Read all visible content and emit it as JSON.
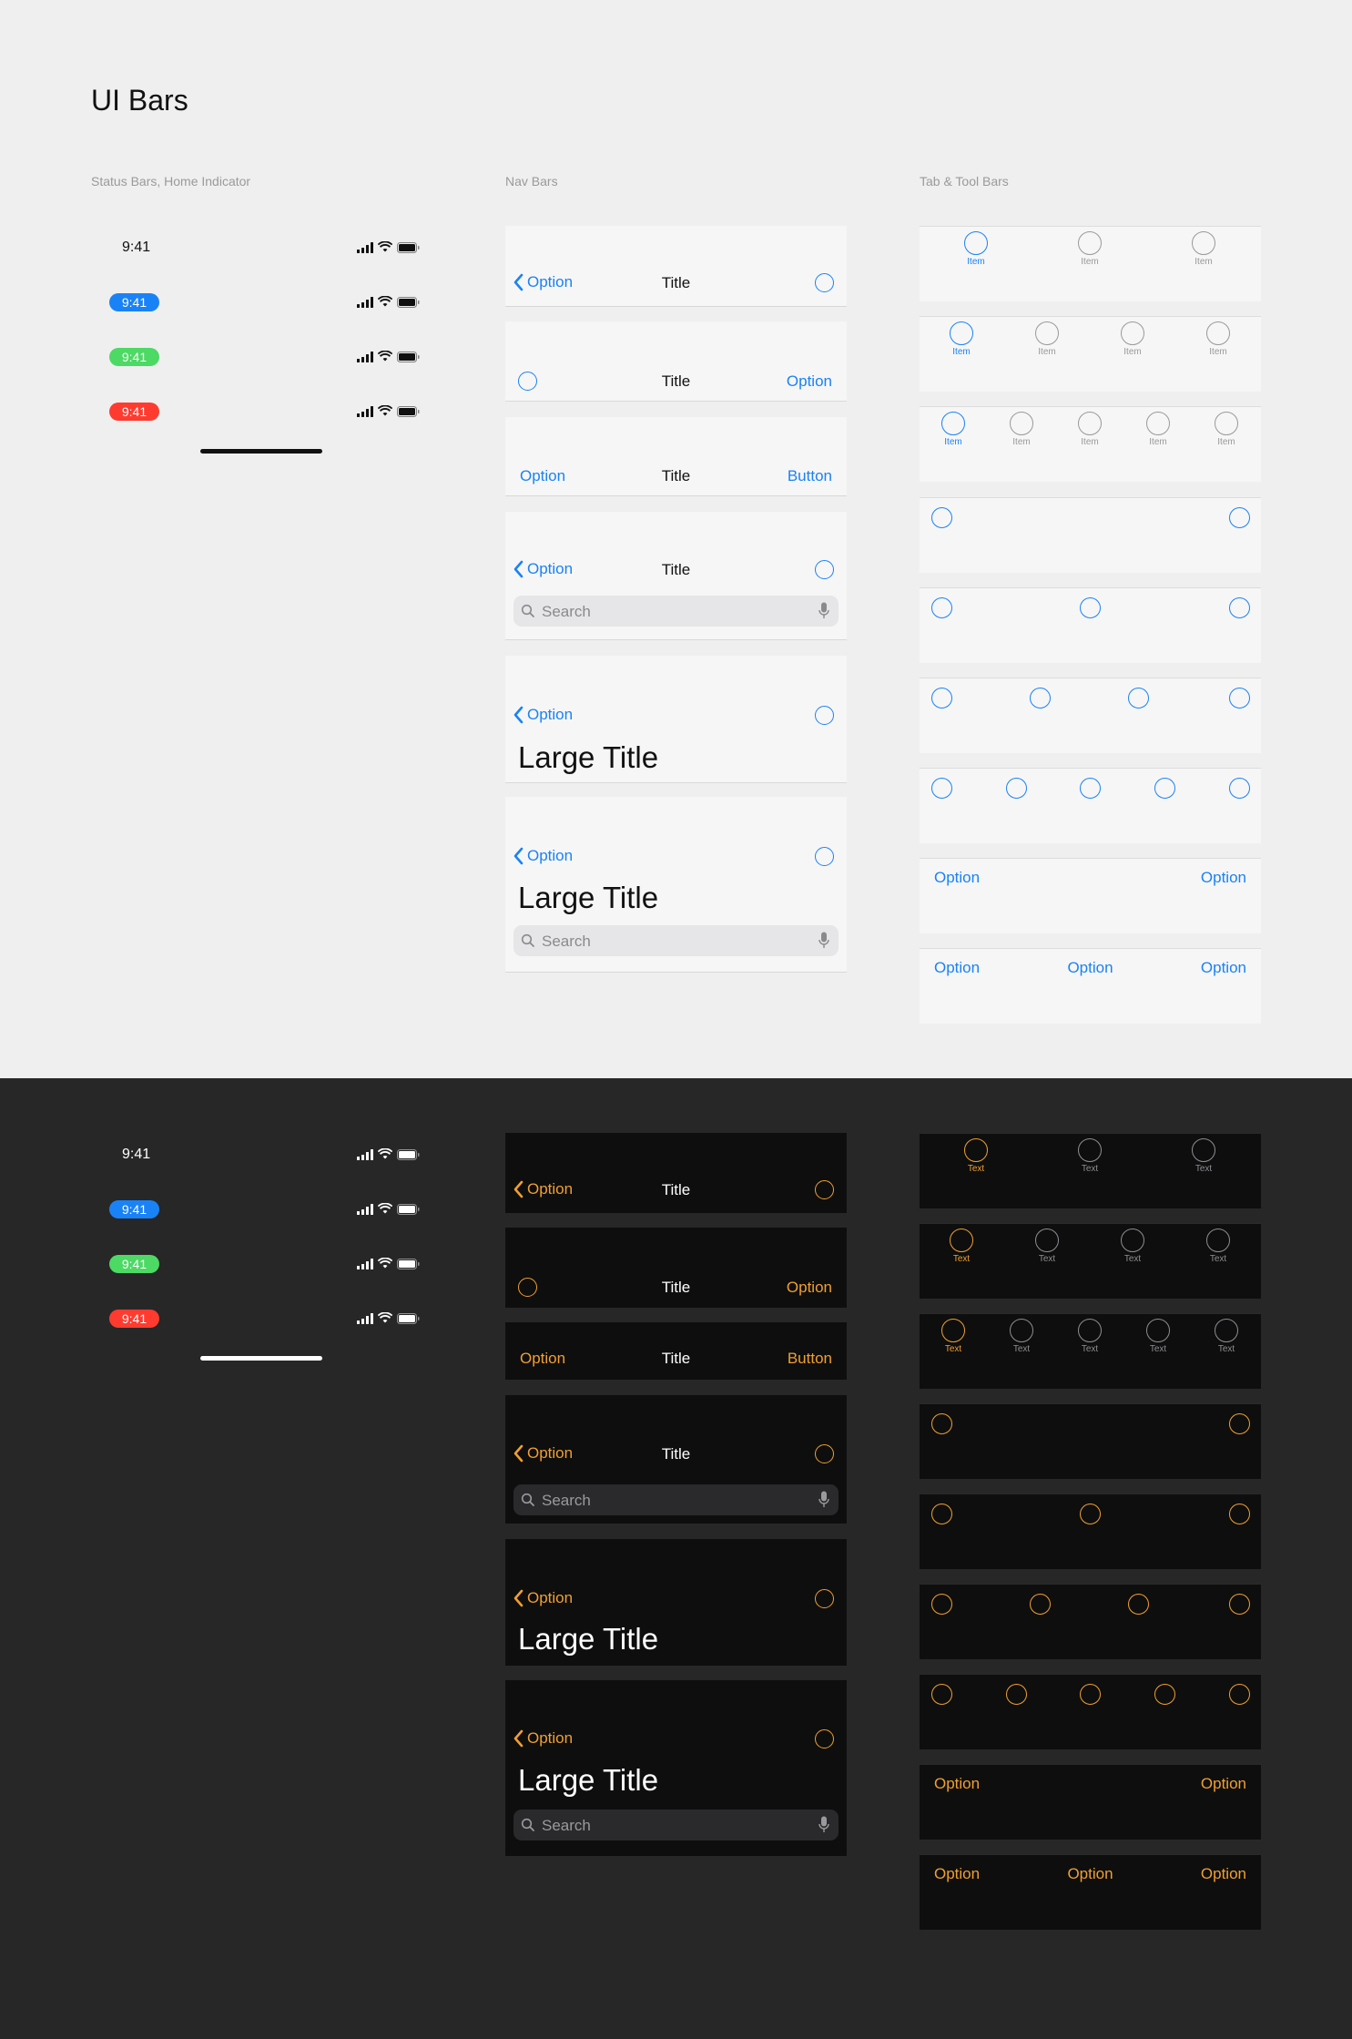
{
  "page_title": "UI Bars",
  "sections": {
    "status": "Status Bars, Home Indicator",
    "nav": "Nav Bars",
    "tab": "Tab & Tool Bars"
  },
  "colors": {
    "light_bg": "#efefef",
    "dark_bg": "#272727",
    "light_bar": "#f6f6f6",
    "dark_bar": "#0e0e0e",
    "blue_accent": "#1a82f7",
    "orange_accent": "#f0a030",
    "green_pill": "#4cd964",
    "red_pill": "#ff3b30",
    "blue_pill": "#1a82f7"
  },
  "status_bars": {
    "time": "9:41",
    "icons": [
      "cellular-signal-icon",
      "wifi-icon",
      "battery-icon"
    ]
  },
  "nav_bars": {
    "back": "Option",
    "title": "Title",
    "option": "Option",
    "button": "Button",
    "large_title": "Large Title",
    "search_placeholder": "Search"
  },
  "tab_bars": {
    "light_item_label": "Item",
    "dark_item_label": "Text",
    "tool_option": "Option"
  }
}
